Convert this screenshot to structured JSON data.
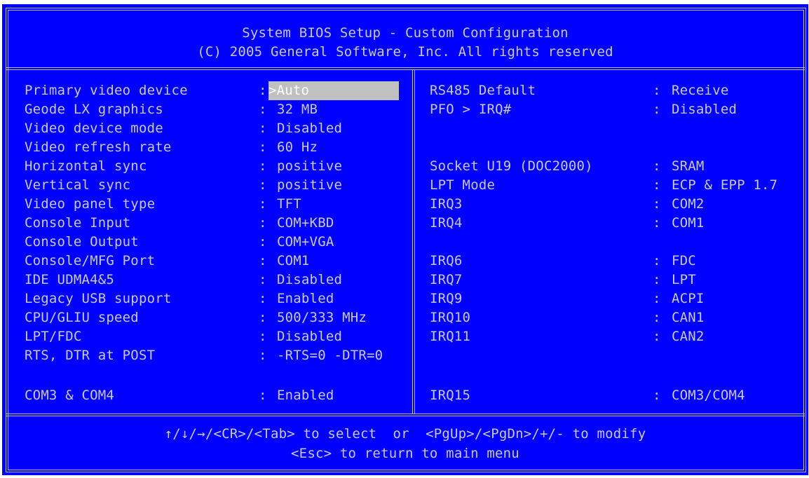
{
  "header": {
    "title": "System BIOS Setup - Custom Configuration",
    "copyright": "(C) 2005 General Software, Inc. All rights reserved"
  },
  "left_items": [
    {
      "label": "Primary video device",
      "sep": ":",
      "value": ">Auto"
    },
    {
      "label": "Geode LX graphics",
      "sep": ":",
      "value": "32 MB"
    },
    {
      "label": "Video device mode",
      "sep": ":",
      "value": "Disabled"
    },
    {
      "label": "Video refresh rate",
      "sep": ":",
      "value": "60 Hz"
    },
    {
      "label": "Horizontal sync",
      "sep": ":",
      "value": "positive"
    },
    {
      "label": "Vertical sync",
      "sep": ":",
      "value": "positive"
    },
    {
      "label": "Video panel type",
      "sep": ":",
      "value": "TFT"
    },
    {
      "label": "Console Input",
      "sep": ":",
      "value": "COM+KBD"
    },
    {
      "label": "Console Output",
      "sep": ":",
      "value": "COM+VGA"
    },
    {
      "label": "Console/MFG Port",
      "sep": ":",
      "value": "COM1"
    },
    {
      "label": "IDE UDMA4&5",
      "sep": ":",
      "value": "Disabled"
    },
    {
      "label": "Legacy USB support",
      "sep": ":",
      "value": "Enabled"
    },
    {
      "label": "CPU/GLIU speed",
      "sep": ":",
      "value": "500/333 MHz"
    },
    {
      "label": "LPT/FDC",
      "sep": ":",
      "value": "Disabled"
    },
    {
      "label": "RTS, DTR at POST",
      "sep": ":",
      "value": "-RTS=0 -DTR=0"
    },
    {
      "label": "COM3 & COM4",
      "sep": ":",
      "value": "Enabled"
    }
  ],
  "right_items": [
    {
      "label": "RS485 Default",
      "sep": ":",
      "value": "Receive"
    },
    {
      "label": "PFO > IRQ#",
      "sep": ":",
      "value": "Disabled"
    },
    {
      "label": "Socket U19 (DOC2000)",
      "sep": ":",
      "value": "SRAM"
    },
    {
      "label": "LPT Mode",
      "sep": ":",
      "value": "ECP & EPP 1.7"
    },
    {
      "label": "IRQ3",
      "sep": ":",
      "value": "COM2"
    },
    {
      "label": "IRQ4",
      "sep": ":",
      "value": "COM1"
    },
    {
      "label": "IRQ6",
      "sep": ":",
      "value": "FDC"
    },
    {
      "label": "IRQ7",
      "sep": ":",
      "value": "LPT"
    },
    {
      "label": "IRQ9",
      "sep": ":",
      "value": "ACPI"
    },
    {
      "label": "IRQ10",
      "sep": ":",
      "value": "CAN1"
    },
    {
      "label": "IRQ11",
      "sep": ":",
      "value": "CAN2"
    },
    {
      "label": "IRQ15",
      "sep": ":",
      "value": "COM3/COM4"
    }
  ],
  "footer": {
    "line1": "↑/↓/→/<CR>/<Tab> to select  or  <PgUp>/<PgDn>/+/- to modify",
    "line2": "<Esc> to return to main menu"
  },
  "colors": {
    "background": "#0000ff",
    "text": "#c8c8c8",
    "highlight": "#c0c0c0"
  }
}
